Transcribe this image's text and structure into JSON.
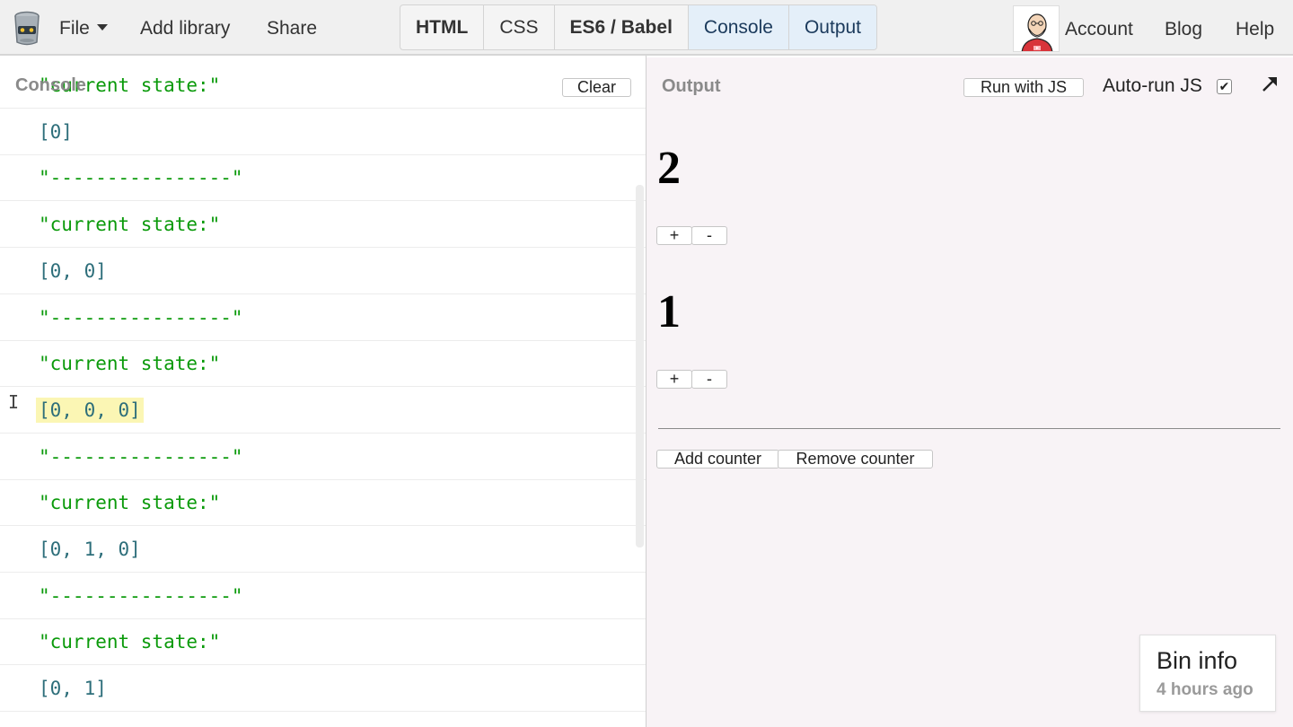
{
  "topbar": {
    "menu": {
      "file": "File",
      "add_library": "Add library",
      "share": "Share"
    },
    "panel_tabs": [
      "HTML",
      "CSS",
      "ES6 / Babel",
      "Console",
      "Output"
    ],
    "active_tabs": [
      "Console",
      "Output"
    ],
    "right_menu": {
      "account": "Account",
      "blog": "Blog",
      "help": "Help"
    }
  },
  "console": {
    "label": "Console",
    "clear_label": "Clear",
    "partial_first_line": "\"current state:\"",
    "lines": [
      "[0]",
      "\"----------------\"",
      "\"current state:\"",
      "[0, 0]",
      "\"----------------\"",
      "\"current state:\"",
      "[0, 0, 0]",
      "\"----------------\"",
      "\"current state:\"",
      "[0, 1, 0]",
      "\"----------------\"",
      "\"current state:\"",
      "[0, 1]",
      "\"----------------\""
    ],
    "highlighted_line": "[0, 0, 0]"
  },
  "output": {
    "label": "Output",
    "run_label": "Run with JS",
    "autorun_label": "Auto-run JS",
    "autorun_checked": true,
    "counters": [
      {
        "value": "2",
        "inc": "+",
        "dec": "-"
      },
      {
        "value": "1",
        "inc": "+",
        "dec": "-"
      }
    ],
    "add_counter": "Add counter",
    "remove_counter": "Remove counter"
  },
  "bin_info": {
    "title": "Bin info",
    "time": "4 hours ago"
  },
  "colors": {
    "string": "#0a9a0a",
    "array": "#2d6e7a",
    "highlight": "#fbf6b4",
    "active_tab": "#e4eff9",
    "output_bg": "#f8f3f6"
  },
  "icons": {
    "logo": "jsbin-logo-icon",
    "avatar": "user-avatar-icon",
    "popout": "popout-arrow-icon",
    "checkbox": "checkmark-icon",
    "cursor": "text-cursor-icon"
  }
}
